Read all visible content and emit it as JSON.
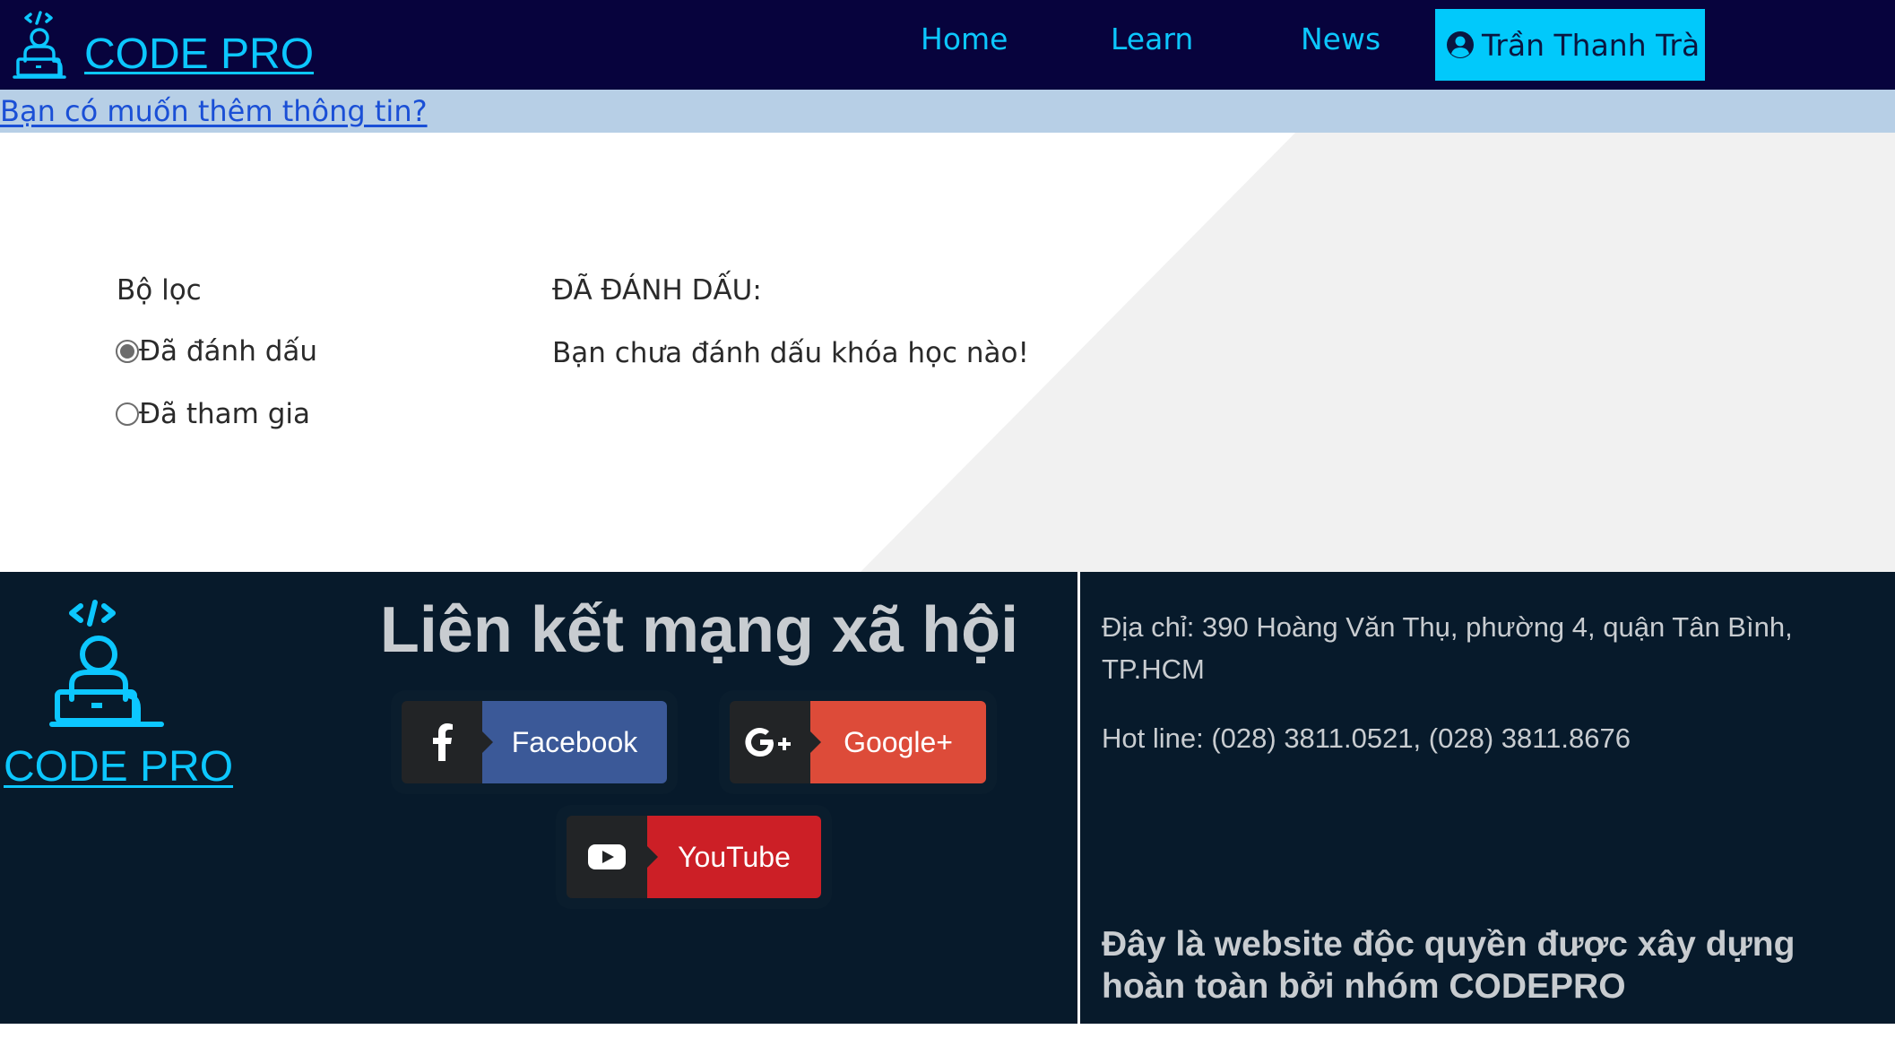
{
  "header": {
    "logo_text": "CODE PRO",
    "nav": [
      {
        "label": "Home"
      },
      {
        "label": "Learn"
      },
      {
        "label": "News"
      }
    ],
    "user_name": "Trần Thanh Trà"
  },
  "info_bar": {
    "link_text": "Bạn có muốn thêm thông tin?"
  },
  "filter": {
    "title": "Bộ lọc",
    "options": [
      {
        "label": "Đã đánh dấu",
        "checked": true
      },
      {
        "label": "Đã tham gia",
        "checked": false
      }
    ]
  },
  "marked": {
    "title": "ĐÃ ĐÁNH DẤU:",
    "empty_message": "Bạn chưa đánh dấu khóa học nào!"
  },
  "footer": {
    "logo_text": "CODE PRO",
    "social_title": "Liên kết mạng xã hội",
    "social_buttons": [
      {
        "label": "Facebook",
        "icon": "facebook-icon",
        "color": "#3b5998"
      },
      {
        "label": "Google+",
        "icon": "google-plus-icon",
        "color": "#dd4b39"
      },
      {
        "label": "YouTube",
        "icon": "youtube-icon",
        "color": "#cc1f26"
      }
    ],
    "address": "Địa chỉ: 390 Hoàng Văn Thụ, phường 4, quận Tân Bình, TP.HCM",
    "hotline": "Hot line: (028) 3811.0521, (028) 3811.8676",
    "claim": "Đây là website độc quyền được xây dựng hoàn toàn bởi nhóm CODEPRO"
  },
  "colors": {
    "nav_bg": "#07033d",
    "accent": "#0cc7ff",
    "user_button": "#01c9fb",
    "info_bar": "#b7cfe6",
    "footer_bg": "#071a2b"
  }
}
